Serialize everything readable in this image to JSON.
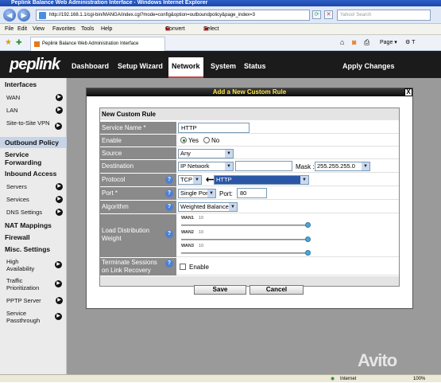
{
  "browser": {
    "title": "Peplink Balance Web Administration Interface - Windows Internet Explorer",
    "url": "http://192.168.1.1/cgi-bin/MANGA/index.cgi?mode=config&option=outboundpolicy&page_index=3",
    "search_placeholder": "Yahoo! Search",
    "menu": [
      "File",
      "Edit",
      "View",
      "Favorites",
      "Tools",
      "Help"
    ],
    "convert_label": "Convert",
    "select_label": "Select",
    "tab_title": "Peplink Balance Web Administration Interface",
    "right_tools": [
      "Page",
      "T"
    ],
    "status_zone": "Internet",
    "status_zoom": "100%"
  },
  "app": {
    "logo": "peplink",
    "nav": [
      "Dashboard",
      "Setup Wizard",
      "Network",
      "System",
      "Status"
    ],
    "apply_label": "Apply Changes"
  },
  "sidebar": {
    "interfaces_heading": "Interfaces",
    "wan": "WAN",
    "lan": "LAN",
    "s2s": "Site-to-Site VPN",
    "outbound": "Outbound Policy",
    "service_fwd": "Service Forwarding",
    "inbound_heading": "Inbound Access",
    "servers": "Servers",
    "services": "Services",
    "dns": "DNS Settings",
    "nat": "NAT Mappings",
    "firewall": "Firewall",
    "misc_heading": "Misc. Settings",
    "ha": "High Availability",
    "traffic": "Traffic Prioritization",
    "pptp": "PPTP Server",
    "passthrough": "Service Passthrough"
  },
  "dialog": {
    "title": "Add a New Custom Rule",
    "close": "X",
    "section": "New Custom Rule",
    "labels": {
      "service_name": "Service Name *",
      "enable": "Enable",
      "source": "Source",
      "destination": "Destination",
      "protocol": "Protocol",
      "port": "Port *",
      "algorithm": "Algorithm",
      "lb_weight": "Load Distribution Weight",
      "terminate": "Terminate Sessions on Link Recovery"
    },
    "service_name_value": "HTTP",
    "enable_yes": "Yes",
    "enable_no": "No",
    "source_value": "Any",
    "destination_type": "IP Network",
    "mask_label": "Mask :",
    "mask_value": "255.255.255.0",
    "protocol_value": "TCP",
    "protocol_preset": "HTTP",
    "port_mode": "Single Port",
    "port_label": "Port:",
    "port_value": "80",
    "algorithm_value": "Weighted Balance",
    "wans": [
      {
        "name": "WAN1",
        "weight": "10",
        "level": 1.0
      },
      {
        "name": "WAN2",
        "weight": "10",
        "level": 1.0
      },
      {
        "name": "WAN3",
        "weight": "10",
        "level": 1.0
      }
    ],
    "terminate_checkbox_label": "Enable",
    "save": "Save",
    "cancel": "Cancel"
  },
  "help_glyph": "?",
  "watermark": "Avito"
}
